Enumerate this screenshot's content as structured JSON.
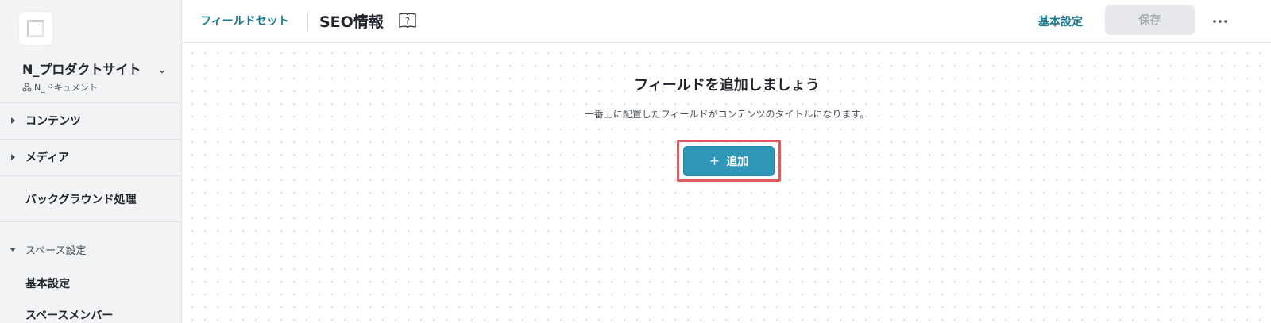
{
  "sidebar": {
    "logo_icon": "logo-mark-icon",
    "space_name": "N_プロダクトサイト",
    "space_sub": "N_ドキュメント",
    "items": [
      {
        "label": "コンテンツ"
      },
      {
        "label": "メディア"
      },
      {
        "label": "バックグラウンド処理"
      },
      {
        "label": "スペース設定"
      },
      {
        "label": "基本設定"
      },
      {
        "label": "スペースメンバー"
      }
    ]
  },
  "header": {
    "breadcrumb": "フィールドセット",
    "title": "SEO情報",
    "basic_settings": "基本設定",
    "save_label": "保存"
  },
  "main": {
    "empty_title": "フィールドを追加しましょう",
    "empty_description": "一番上に配置したフィールドがコンテンツのタイトルになります。",
    "add_label": "追加",
    "add_icon": "+"
  },
  "colors": {
    "accent": "#2e96b6",
    "link": "#1a7a8f",
    "highlight": "#e05a5f"
  }
}
